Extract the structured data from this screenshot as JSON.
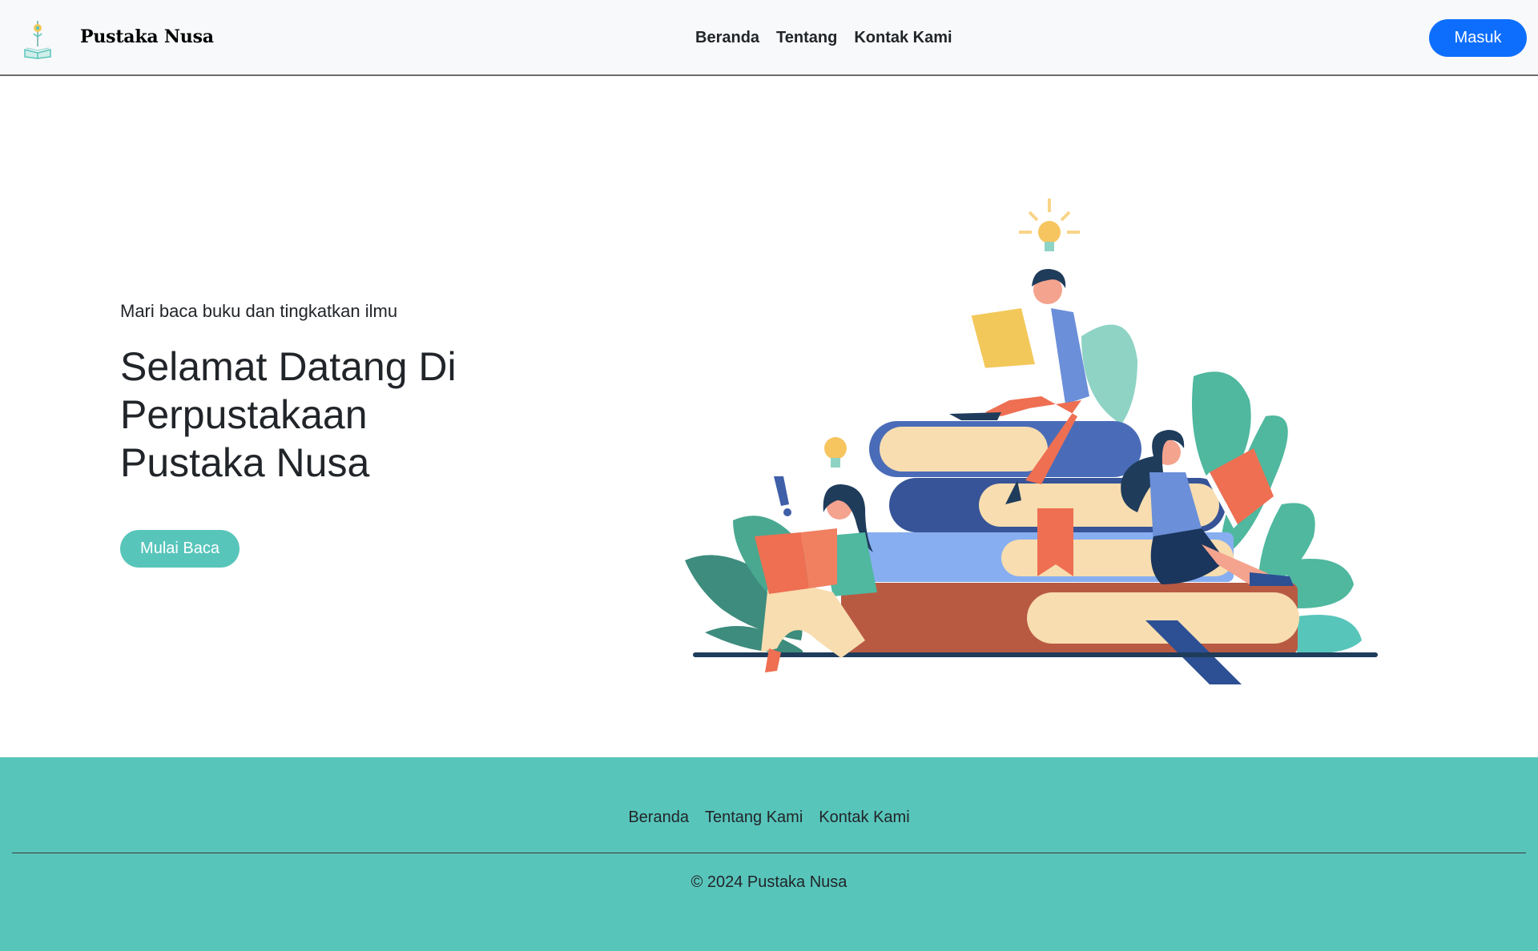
{
  "navbar": {
    "brand_name": "Pustaka Nusa",
    "links": [
      "Beranda",
      "Tentang",
      "Kontak Kami"
    ],
    "login_label": "Masuk"
  },
  "hero": {
    "tagline": "Mari baca buku dan tingkatkan ilmu",
    "title_lines": [
      "Selamat Datang Di",
      "Perpustakaan",
      "Pustaka Nusa"
    ],
    "cta_label": "Mulai Baca"
  },
  "footer": {
    "links": [
      "Beranda",
      "Tentang Kami",
      "Kontak Kami"
    ],
    "copyright": "© 2024 Pustaka Nusa"
  },
  "colors": {
    "primary": "#0d6efd",
    "teal": "#58c5bb",
    "navbar_bg": "#f8f9fa"
  },
  "icons": {
    "brand_logo": "book-lightbulb-logo-icon",
    "illustration": "people-reading-on-books-illustration"
  }
}
